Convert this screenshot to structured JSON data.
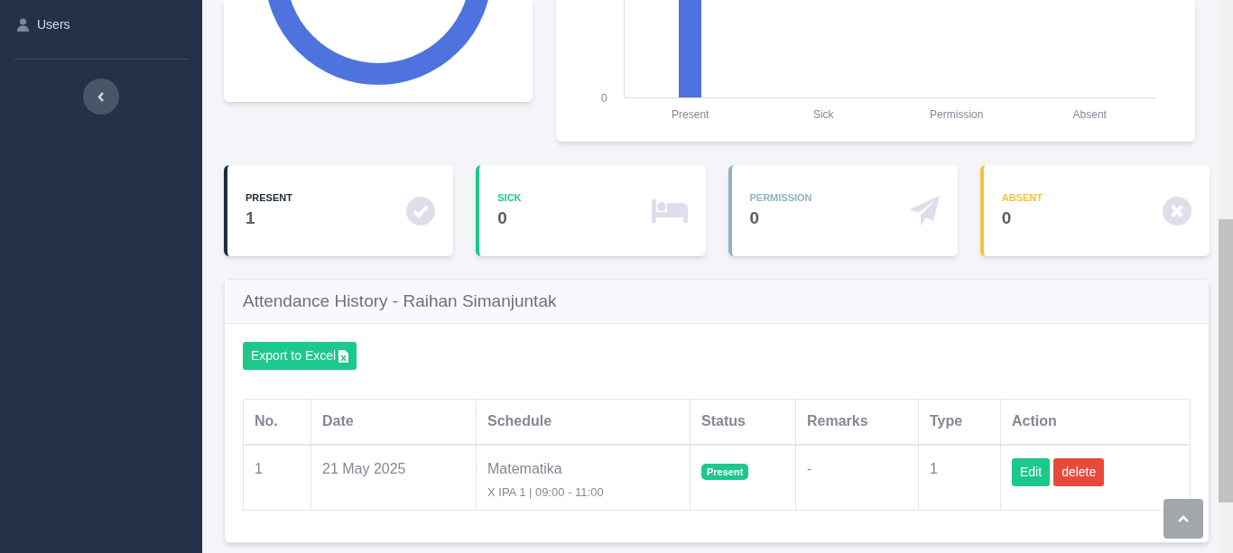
{
  "sidebar": {
    "items": [
      {
        "label": "Users",
        "kind": "user"
      }
    ]
  },
  "chart": {
    "y_tick": "0",
    "categories": [
      "Present",
      "Sick",
      "Permission",
      "Absent"
    ]
  },
  "stats": [
    {
      "label": "PRESENT",
      "value": "1",
      "color": "#1f2d3d",
      "kind": "check"
    },
    {
      "label": "SICK",
      "value": "0",
      "color": "#1cc88a",
      "kind": "bed"
    },
    {
      "label": "PERMISSION",
      "value": "0",
      "color": "#8fb3c4",
      "kind": "plane"
    },
    {
      "label": "ABSENT",
      "value": "0",
      "color": "#f6c23e",
      "kind": "cross"
    }
  ],
  "history": {
    "title": "Attendance History - Raihan Simanjuntak",
    "export_button": "Export to Excel",
    "columns": [
      "No.",
      "Date",
      "Schedule",
      "Status",
      "Remarks",
      "Type",
      "Action"
    ],
    "rows": [
      {
        "no": "1",
        "date": "21 May 2025",
        "schedule": "Matematika",
        "schedule_detail": "X IPA 1 | 09:00 - 11:00",
        "status": "Present",
        "remarks": "-",
        "type": "1",
        "edit": "Edit",
        "delete": "delete"
      }
    ]
  }
}
